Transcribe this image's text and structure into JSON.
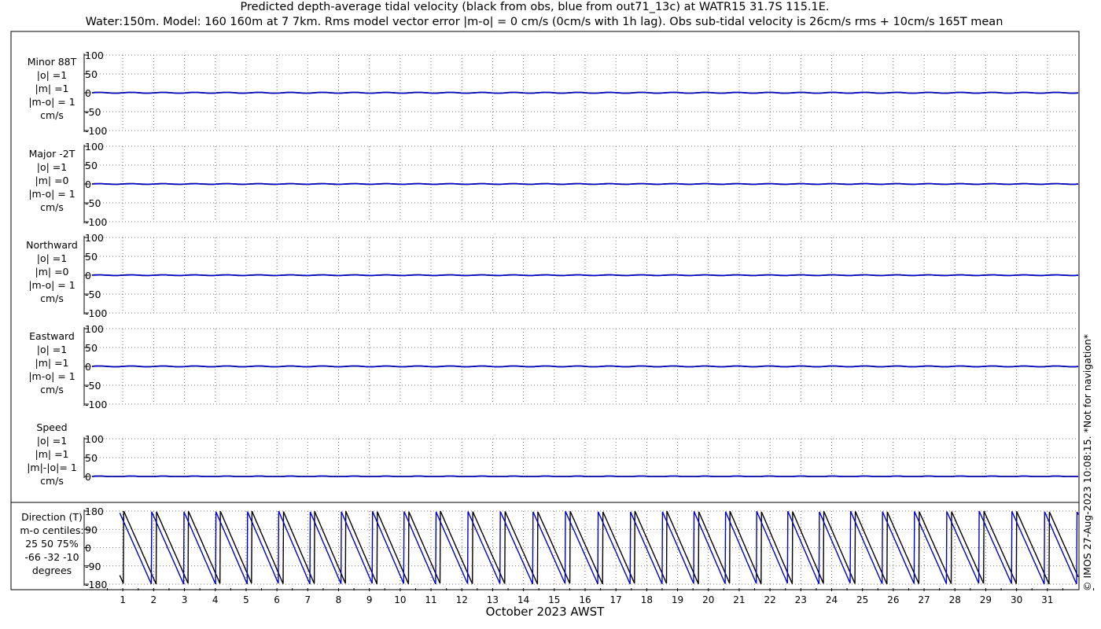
{
  "title_line1": "Predicted depth-average tidal velocity (black from obs, blue from out71_13c) at WATR15 31.7S 115.1E.",
  "title_line2": "Water:150m. Model: 160 160m at 7 7km. Rms model vector error |m-o| = 0 cm/s (0cm/s with 1h lag). Obs sub-tidal velocity is 26cm/s rms + 10cm/s 165T mean",
  "xlabel": "October 2023 AWST",
  "copyright": "© IMOS 27-Aug-2023 10:08:15. *Not for navigation*",
  "colors": {
    "obs": "#000000",
    "model": "#0000cc",
    "grid": "#777777",
    "frame": "#000000"
  },
  "chart_data": {
    "type": "line",
    "x_ticks": [
      "1",
      "2",
      "3",
      "4",
      "5",
      "6",
      "7",
      "8",
      "9",
      "10",
      "11",
      "12",
      "13",
      "14",
      "15",
      "16",
      "17",
      "18",
      "19",
      "20",
      "21",
      "22",
      "23",
      "24",
      "25",
      "26",
      "27",
      "28",
      "29",
      "30",
      "31"
    ],
    "xlim_days": [
      0,
      32
    ],
    "grid": true,
    "series_colors": {
      "obs": "black",
      "model": "blue"
    },
    "panels": [
      {
        "id": "minor",
        "labels": [
          "Minor 88T",
          "|o| =1",
          "|m| =1",
          "|m-o| = 1",
          "cm/s"
        ],
        "yticks": [
          "100",
          "50",
          "0",
          "-50",
          "-100"
        ],
        "ylim": [
          -100,
          100
        ],
        "obs_amp": 1,
        "model_amp": 1
      },
      {
        "id": "major",
        "labels": [
          "Major -2T",
          "|o| =1",
          "|m| =0",
          "|m-o| = 1",
          "cm/s"
        ],
        "yticks": [
          "100",
          "50",
          "0",
          "-50",
          "-100"
        ],
        "ylim": [
          -100,
          100
        ],
        "obs_amp": 1,
        "model_amp": 0
      },
      {
        "id": "northward",
        "labels": [
          "Northward",
          "|o| =1",
          "|m| =0",
          "|m-o| = 1",
          "cm/s"
        ],
        "yticks": [
          "100",
          "50",
          "0",
          "-50",
          "-100"
        ],
        "ylim": [
          -100,
          100
        ],
        "obs_amp": 1,
        "model_amp": 0
      },
      {
        "id": "eastward",
        "labels": [
          "Eastward",
          "|o| =1",
          "|m| =1",
          "|m-o| = 1",
          "cm/s"
        ],
        "yticks": [
          "100",
          "50",
          "0",
          "-50",
          "-100"
        ],
        "ylim": [
          -100,
          100
        ],
        "obs_amp": 1,
        "model_amp": 1
      },
      {
        "id": "speed",
        "labels": [
          "Speed",
          "|o| =1",
          "|m| =1",
          "|m|-|o|= 1",
          "cm/s"
        ],
        "yticks": [
          "100",
          "50",
          "0"
        ],
        "ylim": [
          0,
          100
        ],
        "obs_amp": 1,
        "model_amp": 1
      },
      {
        "id": "direction",
        "labels": [
          "Direction (T)",
          "m-o centiles:",
          "25  50  75%",
          "-66 -32 -10",
          "degrees"
        ],
        "yticks": [
          "180",
          "90",
          "0",
          "-90",
          "-180"
        ],
        "ylim": [
          -180,
          180
        ],
        "period_days": 1.035
      }
    ]
  }
}
